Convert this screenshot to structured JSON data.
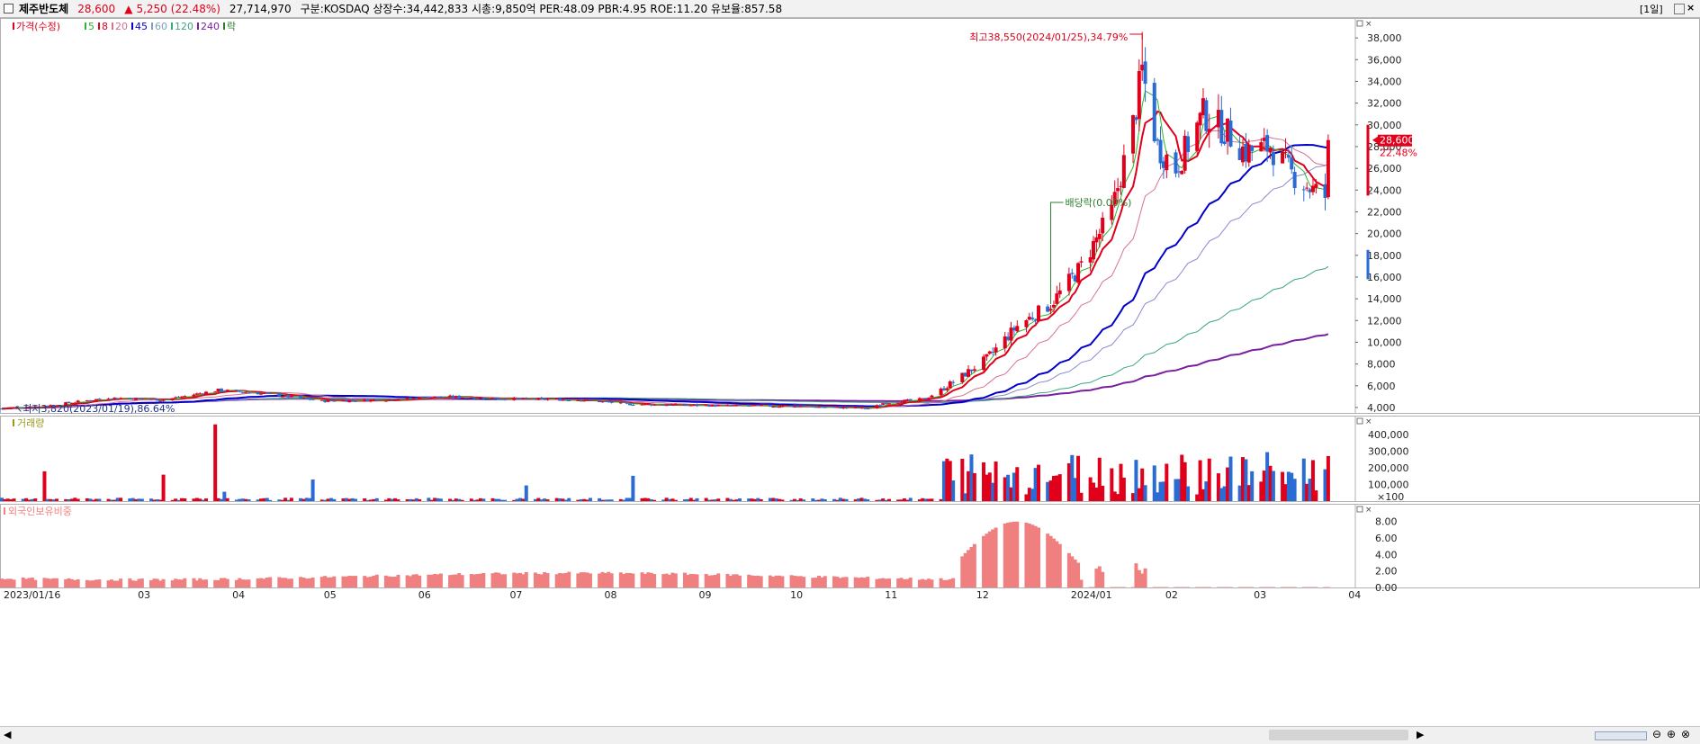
{
  "header": {
    "stock_name": "제주반도체",
    "price": "28,600",
    "change_arrow": "▲",
    "change": "5,250",
    "change_pct": "(22.48%)",
    "volume": "27,714,970",
    "info": "구분:KOSDAQ 상장수:34,442,833 시총:9,850억 PER:48.09 PBR:4.95 ROE:11.20 유보율:857.58",
    "period_button": "[1일]"
  },
  "colors": {
    "up": "#e0001b",
    "down": "#2a6cd4",
    "ma5": "#2db52d",
    "ma20": "#d87093",
    "ma45": "#0000c8",
    "ma60": "#8a8ad0",
    "ma120": "#3aa87a",
    "ma240": "#7a1fa2"
  },
  "price_panel": {
    "legend": [
      {
        "label": "가격(수정)",
        "color": "#e0001b"
      },
      {
        "label": "5",
        "color": "#2db52d"
      },
      {
        "label": "8",
        "color": "#e0001b"
      },
      {
        "label": "20",
        "color": "#d87093"
      },
      {
        "label": "45",
        "color": "#0000c8"
      },
      {
        "label": "60",
        "color": "#7f9fc0"
      },
      {
        "label": "120",
        "color": "#3aa87a"
      },
      {
        "label": "240",
        "color": "#7a1fa2"
      },
      {
        "label": "락",
        "color": "#2d7d2d"
      }
    ],
    "max_annotation": "최고38,550(2024/01/25),34.79%",
    "min_annotation": "최저3,820(2023/01/19),86.64%",
    "dividend_annotation": "배당락(0.00%)",
    "yticks": [
      "4,000",
      "6,000",
      "8,000",
      "10,000",
      "12,000",
      "14,000",
      "16,000",
      "18,000",
      "20,000",
      "22,000",
      "24,000",
      "26,000",
      "28,000",
      "30,000",
      "32,000",
      "34,000",
      "36,000",
      "38,000"
    ],
    "current_price_tag": "28,600",
    "current_pct_tag": "22.48%"
  },
  "volume_panel": {
    "legend": "거래량",
    "yticks": [
      "400,000",
      "300,000",
      "200,000",
      "100,000"
    ],
    "unit": "×100"
  },
  "foreign_panel": {
    "legend": "외국인보유비중",
    "yticks": [
      "8.00",
      "6.00",
      "4.00",
      "2.00",
      "0.00"
    ]
  },
  "x_labels": [
    "2023/01/16",
    "03",
    "04",
    "05",
    "06",
    "07",
    "08",
    "09",
    "10",
    "11",
    "12",
    "2024/01",
    "02",
    "03",
    "04"
  ],
  "chart_data": {
    "type": "candlestick",
    "x": [
      "2023/01/16",
      "2023/02",
      "2023/03",
      "2023/04",
      "2023/05",
      "2023/06",
      "2023/07",
      "2023/08",
      "2023/09",
      "2023/10",
      "2023/11",
      "2023/11-late",
      "2023/12",
      "2023/12-late",
      "2024/01",
      "2024/01/25",
      "2024/02",
      "2024/02-mid",
      "2024/03",
      "2024/03-late"
    ],
    "close": [
      3900,
      4700,
      4600,
      5600,
      4600,
      5000,
      4700,
      4300,
      4200,
      3900,
      4300,
      6500,
      11500,
      13500,
      20000,
      33000,
      26000,
      31000,
      25500,
      28600
    ],
    "max": {
      "value": 38550,
      "date": "2024/01/25"
    },
    "min": {
      "value": 3820,
      "date": "2023/01/19"
    },
    "last_price": 28600,
    "last_change": 5250,
    "last_change_pct": 22.48,
    "ylim": [
      3500,
      39500
    ],
    "moving_averages": [
      5,
      8,
      20,
      45,
      60,
      120,
      240
    ],
    "volume_ylim_x100": [
      0,
      480000
    ],
    "foreign_ratio_ylim": [
      0,
      9.5
    ]
  }
}
